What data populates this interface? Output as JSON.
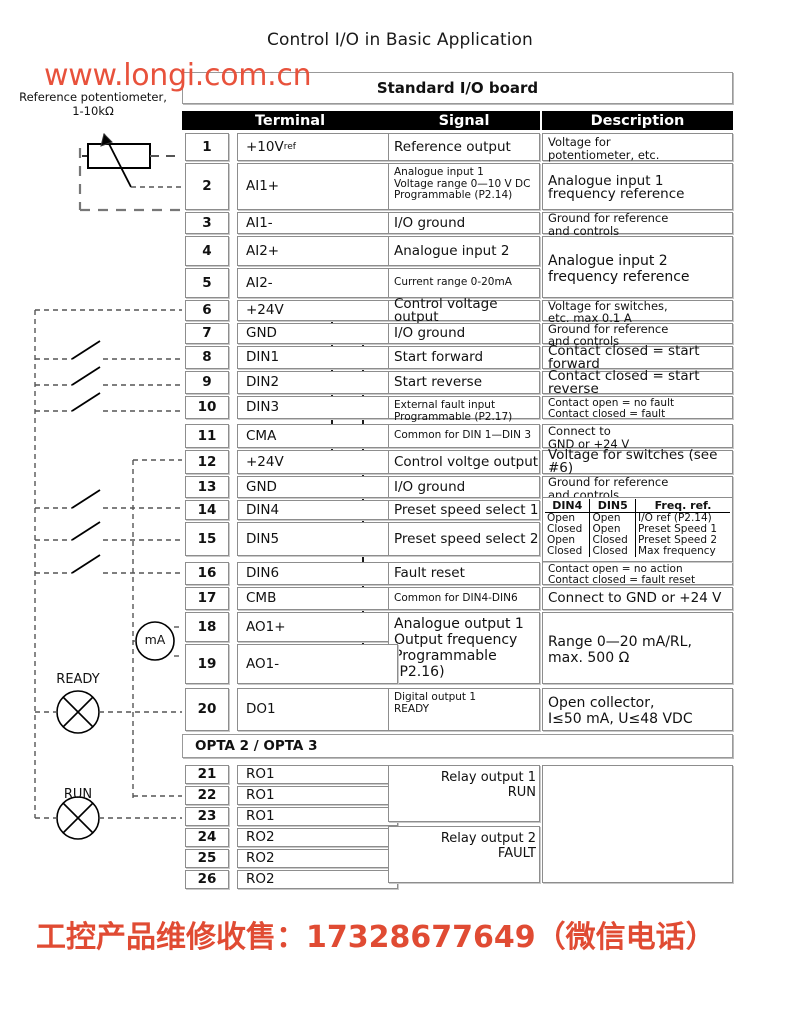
{
  "title": "Control I/O in Basic Application",
  "watermark": "www.longi.com.cn",
  "footer_cn": "工控产品维修收售：17328677649（微信电话）",
  "colors": {
    "accent_red": "#e8523c",
    "header_bg": "#000000",
    "header_fg": "#ffffff"
  },
  "left_diagram": {
    "potentiometer_caption_line1": "Reference potentiometer,",
    "potentiometer_caption_line2": "1-10kΩ",
    "meter_label": "mA",
    "lamp_ready": "READY",
    "lamp_run": "RUN"
  },
  "boards": {
    "standard": "Standard I/O board",
    "opta": "OPTA 2 / OPTA 3"
  },
  "columns": {
    "terminal": "Terminal",
    "signal": "Signal",
    "description": "Description"
  },
  "rows": [
    {
      "num": "1",
      "terminal": "+10V",
      "terminal_sub": "ref",
      "signal": "Reference output",
      "description": "Voltage for\npotentiometer, etc."
    },
    {
      "num": "2",
      "terminal": "AI1+",
      "signal": "Analogue input 1\nVoltage range 0—10 V DC\nProgrammable (P2.14)",
      "description": "Analogue input 1\nfrequency reference"
    },
    {
      "num": "3",
      "terminal": "AI1-",
      "signal": "I/O ground",
      "description": "Ground for reference\nand controls"
    },
    {
      "num": "4",
      "terminal": "AI2+",
      "signal": "Analogue input 2",
      "description": "Analogue input 2\nfrequency reference"
    },
    {
      "num": "5",
      "terminal": "AI2-",
      "signal": "Current range 0-20mA",
      "description": ""
    },
    {
      "num": "6",
      "terminal": "+24V",
      "signal": "Control voltage output",
      "description": "Voltage for switches,\netc. max 0.1 A"
    },
    {
      "num": "7",
      "terminal": "GND",
      "signal": "I/O ground",
      "description": "Ground for reference\nand controls"
    },
    {
      "num": "8",
      "terminal": "DIN1",
      "signal": "Start forward",
      "description": "Contact closed = start forward"
    },
    {
      "num": "9",
      "terminal": "DIN2",
      "signal": "Start reverse",
      "description": "Contact closed = start reverse"
    },
    {
      "num": "10",
      "terminal": "DIN3",
      "signal": "External fault input\nProgrammable (P2.17)",
      "description": "Contact open = no fault\nContact closed = fault"
    },
    {
      "num": "11",
      "terminal": "CMA",
      "signal": "Common for DIN 1—DIN 3",
      "description": "Connect to\nGND or +24 V"
    },
    {
      "num": "12",
      "terminal": "+24V",
      "signal": "Control voltge output",
      "description": "Voltage for switches (see #6)"
    },
    {
      "num": "13",
      "terminal": "GND",
      "signal": "I/O ground",
      "description": "Ground for reference\nand controls"
    },
    {
      "num": "14",
      "terminal": "DIN4",
      "signal": "Preset speed select 1",
      "description": ""
    },
    {
      "num": "15",
      "terminal": "DIN5",
      "signal": "Preset speed select 2",
      "description": ""
    },
    {
      "num": "16",
      "terminal": "DIN6",
      "signal": "Fault reset",
      "description": "Contact open = no action\nContact closed = fault reset"
    },
    {
      "num": "17",
      "terminal": "CMB",
      "signal": "Common for DIN4-DIN6",
      "description": "Connect to GND or +24 V"
    },
    {
      "num": "18",
      "terminal": "AO1+",
      "signal": "Analogue output 1\nOutput frequency\nProgrammable\n(P2.16)",
      "description": "Range 0—20 mA/RL,\nmax. 500 Ω"
    },
    {
      "num": "19",
      "terminal": "AO1-",
      "signal": "",
      "description": ""
    },
    {
      "num": "20",
      "terminal": "DO1",
      "signal": "Digital output 1\nREADY",
      "description": "Open collector,\nI≤50 mA, U≤48 VDC"
    },
    {
      "num": "21",
      "terminal": "RO1",
      "signal": "",
      "description": ""
    },
    {
      "num": "22",
      "terminal": "RO1",
      "signal": "",
      "description": ""
    },
    {
      "num": "23",
      "terminal": "RO1",
      "signal": "",
      "description": ""
    },
    {
      "num": "24",
      "terminal": "RO2",
      "signal": "",
      "description": ""
    },
    {
      "num": "25",
      "terminal": "RO2",
      "signal": "",
      "description": ""
    },
    {
      "num": "26",
      "terminal": "RO2",
      "signal": "",
      "description": ""
    }
  ],
  "truth_table": {
    "headers": [
      "DIN4",
      "DIN5",
      "Freq. ref."
    ],
    "rows": [
      [
        "Open",
        "Open",
        "I/O ref (P2.14)"
      ],
      [
        "Closed",
        "Open",
        "Preset Speed 1"
      ],
      [
        "Open",
        "Closed",
        "Preset Speed 2"
      ],
      [
        "Closed",
        "Closed",
        "Max frequency"
      ]
    ]
  },
  "relays": [
    {
      "label_line1": "Relay output 1",
      "label_line2": "RUN"
    },
    {
      "label_line1": "Relay output 2",
      "label_line2": "FAULT"
    }
  ]
}
